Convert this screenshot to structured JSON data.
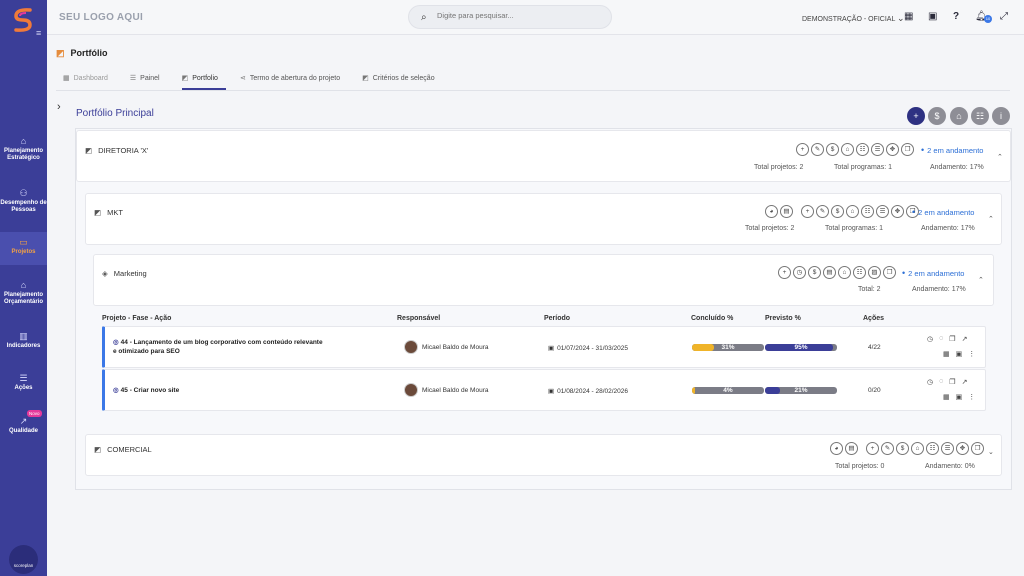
{
  "sidebar": {
    "items": [
      {
        "label": "Planejamento Estratégico",
        "icon": "home-icon"
      },
      {
        "label": "Desempenho de Pessoas",
        "icon": "people-icon"
      },
      {
        "label": "Projetos",
        "icon": "briefcase-icon"
      },
      {
        "label": "Planejamento Orçamentário",
        "icon": "bank-icon"
      },
      {
        "label": "Indicadores",
        "icon": "bar-chart-icon"
      },
      {
        "label": "Ações",
        "icon": "list-icon"
      },
      {
        "label": "Qualidade",
        "icon": "trend-icon"
      }
    ],
    "new_badge": "Novo",
    "brand": "scoreplan"
  },
  "topbar": {
    "logo_text": "SEU LOGO AQUI",
    "search_placeholder": "Digite para pesquisar...",
    "org_selector": "DEMONSTRAÇÃO - OFICIAL",
    "notification_count": "10"
  },
  "page": {
    "title": "Portfólio"
  },
  "tabs": [
    {
      "label": "Dashboard",
      "icon": "grid-icon"
    },
    {
      "label": "Painel",
      "icon": "list-icon"
    },
    {
      "label": "Portfolio",
      "icon": "portfolio-icon"
    },
    {
      "label": "Termo de abertura do projeto",
      "icon": "share-icon"
    },
    {
      "label": "Critérios de seleção",
      "icon": "criteria-icon"
    }
  ],
  "portfolio": {
    "title": "Portfólio Principal",
    "diretoria": {
      "name": "DIRETORIA 'X'",
      "status": "2 em andamento",
      "total_projetos": "Total projetos: 2",
      "total_programas": "Total programas: 1",
      "andamento": "Andamento: 17%"
    },
    "mkt": {
      "name": "MKT",
      "status": "2 em andamento",
      "total_projetos": "Total projetos: 2",
      "total_programas": "Total programas: 1",
      "andamento": "Andamento: 17%"
    },
    "marketing": {
      "name": "Marketing",
      "status": "2 em andamento",
      "total": "Total: 2",
      "andamento": "Andamento: 17%"
    },
    "comercial": {
      "name": "COMERCIAL",
      "total_projetos": "Total projetos: 0",
      "andamento": "Andamento: 0%"
    }
  },
  "table": {
    "headers": {
      "projeto": "Projeto - Fase - Ação",
      "responsavel": "Responsável",
      "periodo": "Período",
      "concluido": "Concluído %",
      "previsto": "Previsto %",
      "acoes": "Ações"
    },
    "rows": [
      {
        "name_line1": "44 - Lançamento de um blog corporativo com conteúdo relevante",
        "name_line2": "e otimizado para SEO",
        "responsavel": "Micael Baldo de Moura",
        "periodo": "01/07/2024 - 31/03/2025",
        "concluido": "31%",
        "concluido_value": 31,
        "previsto": "95%",
        "previsto_value": 95,
        "acoes": "4/22"
      },
      {
        "name_line1": "45 - Criar novo site",
        "name_line2": "",
        "responsavel": "Micael Baldo de Moura",
        "periodo": "01/08/2024 - 28/02/2026",
        "concluido": "4%",
        "concluido_value": 4,
        "previsto": "21%",
        "previsto_value": 21,
        "acoes": "0/20"
      }
    ]
  },
  "colors": {
    "sidebar": "#3b3e98",
    "accent": "#3b78e7",
    "concluido_fill": "#f0b429",
    "previsto_fill": "#3b3e98",
    "status_text": "#2c6fd6"
  }
}
